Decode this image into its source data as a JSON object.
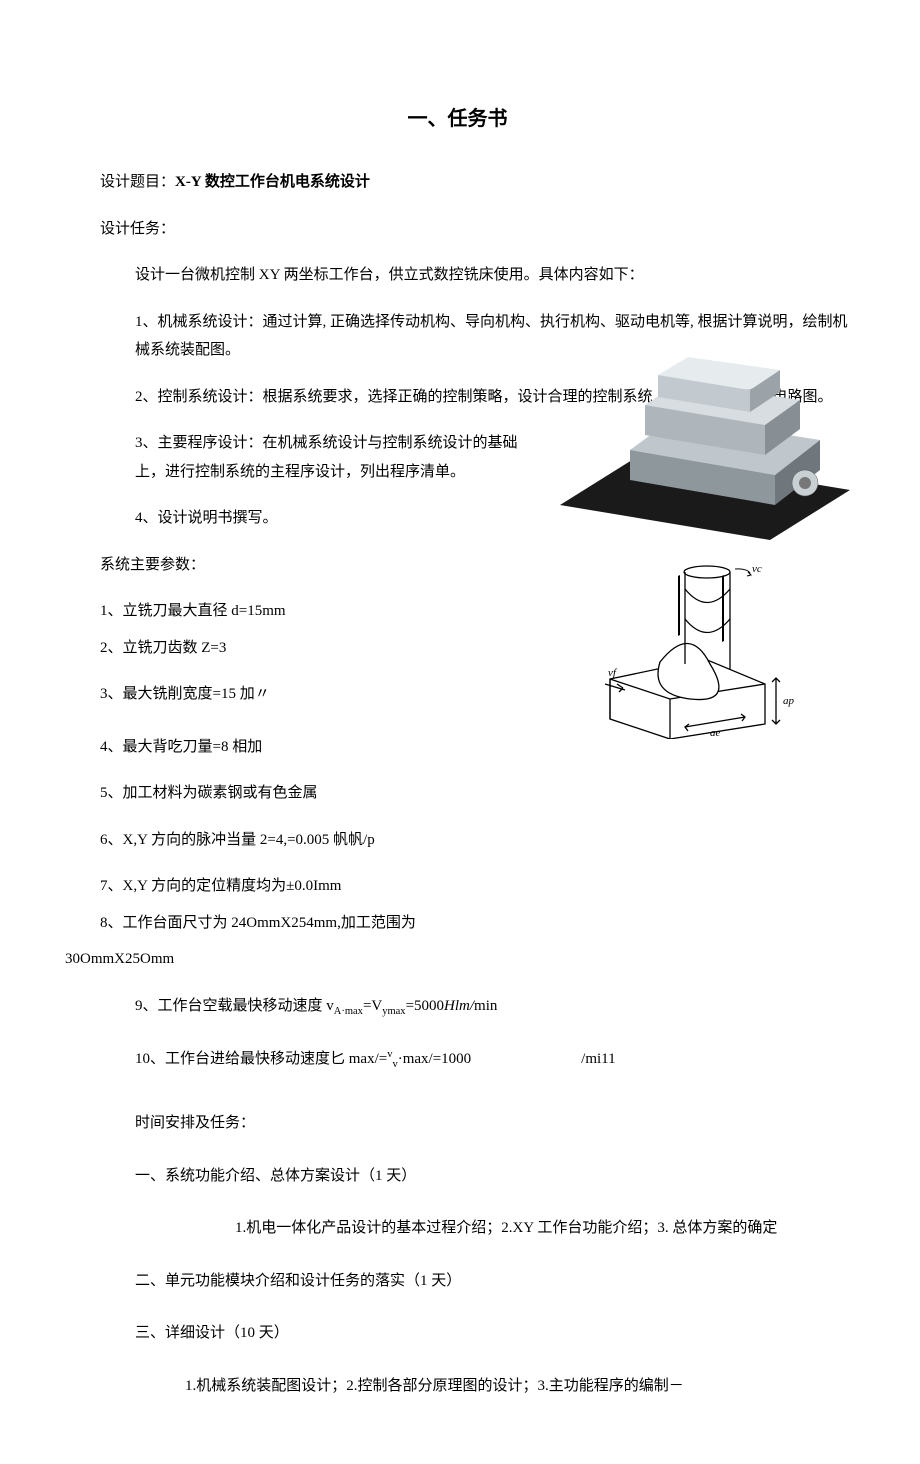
{
  "title": "一、任务书",
  "topic_label": "设计题目：",
  "topic_value": "X-Y 数控工作台机电系统设计",
  "task_label": "设计任务：",
  "task_intro": "设计一台微机控制 XY 两坐标工作台，供立式数控铣床使用。具体内容如下：",
  "tasks": [
    "1、机械系统设计：通过计算, 正确选择传动机构、导向机构、执行机构、驱动电机等, 根据计算说明，绘制机械系统装配图。",
    "2、控制系统设计：根据系统要求，选择正确的控制策略，设计合理的控制系统，并绘制控制系统电路图。",
    "3、主要程序设计：在机械系统设计与控制系统设计的基础上，进行控制系统的主程序设计，列出程序清单。",
    "4、设计说明书撰写。"
  ],
  "params_label": "系统主要参数：",
  "params": [
    "1、立铣刀最大直径 d=15mm",
    "2、立铣刀齿数 Z=3",
    "3、最大铣削宽度=15 加〃",
    "4、最大背吃刀量=8 相加",
    "5、加工材料为碳素钢或有色金属",
    "6、X,Y 方向的脉冲当量 2=4,=0.005 帆帆/p",
    "7、X,Y 方向的定位精度均为±0.0Imm",
    "8、工作台面尺寸为 24OmmX254mm,加工范围为"
  ],
  "param8_cont": "30OmmX25Omm",
  "param9_pre": "9、工作台空载最快移动速度 v",
  "param9_sub1": "A·max",
  "param9_mid": "=V",
  "param9_sub2": "ymax",
  "param9_post": "=5000",
  "param9_ital": "Hlm/",
  "param9_end": "min",
  "param10_pre": "10、工作台进给最快移动速度匕 max/=",
  "param10_sup": "v",
  "param10_sub": "v",
  "param10_mid": "·max/=1000",
  "param10_tail": "/mi11",
  "schedule_label": "时间安排及任务：",
  "schedule": [
    {
      "h": "一、系统功能介绍、总体方案设计（1 天）",
      "d": "1.机电一体化产品设计的基本过程介绍；2.XY 工作台功能介绍；3. 总体方案的确定"
    },
    {
      "h": "二、单元功能模块介绍和设计任务的落实（1 天）",
      "d": ""
    },
    {
      "h": "三、详细设计（10 天）",
      "d": "1.机械系统装配图设计；2.控制各部分原理图的设计；3.主功能程序的编制－"
    }
  ],
  "figures": {
    "fig1_alt": "xy-stage-photo",
    "fig2_alt": "milling-cutter-diagram",
    "fig2_labels": {
      "vc": "vc",
      "vf": "vf",
      "ap": "ap",
      "ae": "ae"
    }
  }
}
